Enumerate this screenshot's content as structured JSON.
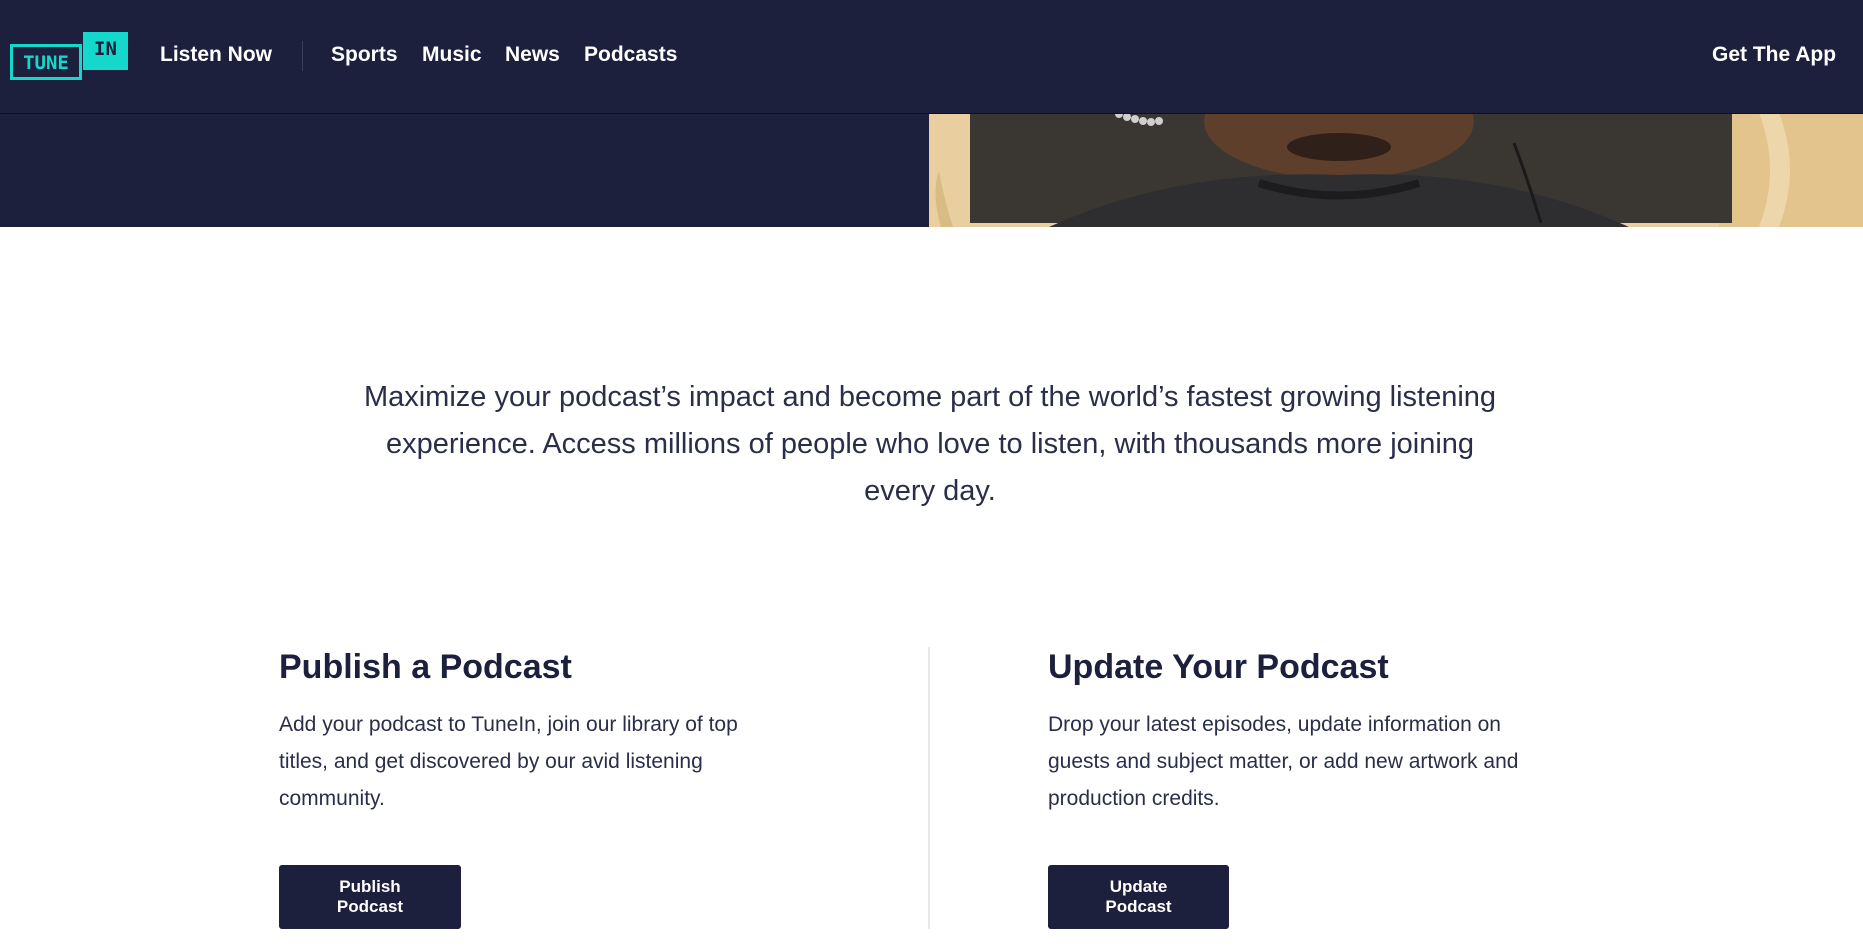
{
  "nav": {
    "logo_tune": "TUNE",
    "logo_in": "IN",
    "listen_now": "Listen Now",
    "links": [
      "Sports",
      "Music",
      "News",
      "Podcasts"
    ],
    "get_app": "Get The App"
  },
  "intro": {
    "text": "Maximize your podcast’s impact and become part of the world’s fastest growing listening experience. Access millions of people who love to listen, with thousands more joining every day."
  },
  "publish": {
    "title": "Publish a Podcast",
    "description": "Add your podcast to TuneIn, join our library of top titles, and get discovered by our avid listening community.",
    "button": "Publish Podcast"
  },
  "update": {
    "title": "Update Your Podcast",
    "description": "Drop your latest episodes, update information on guests and subject matter, or add new artwork and production credits.",
    "button": "Update Podcast"
  },
  "colors": {
    "navy": "#1c203c",
    "teal": "#14d8cc",
    "tan": "#e9cf9f"
  }
}
